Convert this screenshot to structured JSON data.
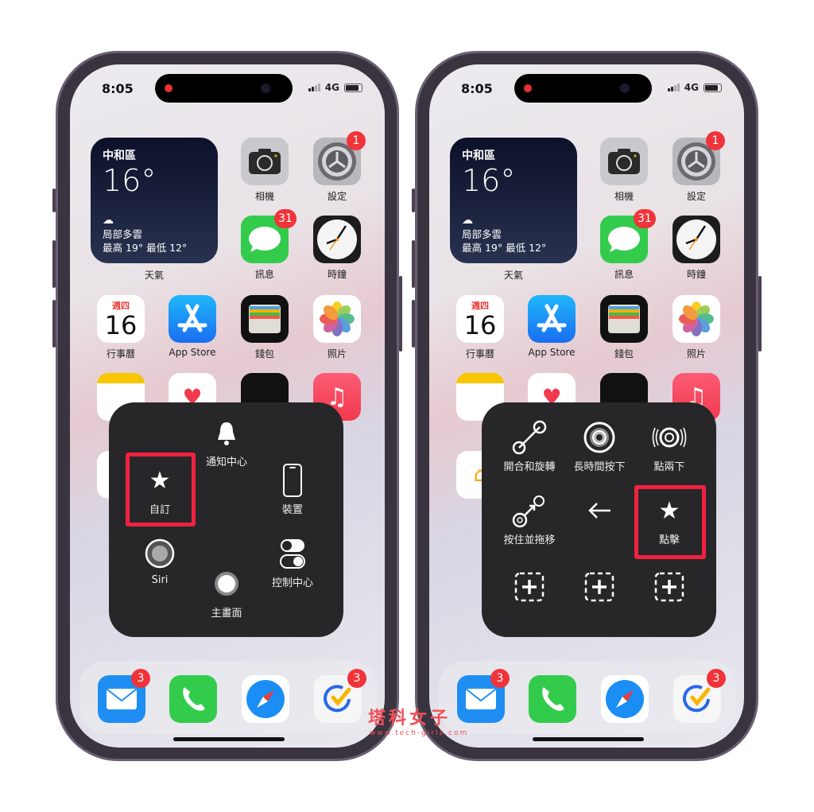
{
  "colors": {
    "badge": "#f0343a",
    "highlight": "#f0213f",
    "menu_bg": "#27272a",
    "watermark": "#f05058"
  },
  "status_bar": {
    "time": "8:05",
    "network": "4G"
  },
  "weather_widget": {
    "location": "中和區",
    "temperature": "16°",
    "condition": "局部多雲",
    "high_low": "最高 19° 最低 12°",
    "label": "天氣"
  },
  "apps": [
    {
      "label": "相機",
      "icon": "camera-icon"
    },
    {
      "label": "設定",
      "icon": "settings-icon",
      "badge": "1"
    },
    {
      "label": "訊息",
      "icon": "messages-icon",
      "badge": "31"
    },
    {
      "label": "時鐘",
      "icon": "clock-icon"
    },
    {
      "label": "行事曆",
      "icon": "calendar-icon",
      "weekday": "週四",
      "day": "16"
    },
    {
      "label": "App Store",
      "icon": "app-store-icon"
    },
    {
      "label": "錢包",
      "icon": "wallet-icon"
    },
    {
      "label": "照片",
      "icon": "photos-icon"
    }
  ],
  "dock": [
    {
      "icon": "mail-icon",
      "badge": "3"
    },
    {
      "icon": "phone-icon"
    },
    {
      "icon": "safari-icon"
    },
    {
      "icon": "tasks-icon",
      "badge": "3"
    }
  ],
  "left_menu": {
    "items": [
      {
        "label": "通知中心",
        "icon": "bell-icon"
      },
      {
        "label": "自訂",
        "icon": "star-icon",
        "highlighted": true
      },
      {
        "label": "裝置",
        "icon": "device-icon"
      },
      {
        "label": "Siri",
        "icon": "siri-icon"
      },
      {
        "label": "控制中心",
        "icon": "toggle-icon"
      },
      {
        "label": "主畫面",
        "icon": "home-button-icon"
      }
    ]
  },
  "right_menu": {
    "items": [
      {
        "label": "開合和旋轉",
        "icon": "pinch-rotate-icon"
      },
      {
        "label": "長時間按下",
        "icon": "long-press-icon"
      },
      {
        "label": "點兩下",
        "icon": "double-tap-icon"
      },
      {
        "label": "按住並拖移",
        "icon": "drag-icon"
      },
      {
        "label": "",
        "icon": "back-arrow-icon"
      },
      {
        "label": "點擊",
        "icon": "star-icon",
        "highlighted": true
      },
      {
        "label": "",
        "icon": "add-slot-icon"
      },
      {
        "label": "",
        "icon": "add-slot-icon"
      },
      {
        "label": "",
        "icon": "add-slot-icon"
      }
    ]
  },
  "watermark": {
    "name": "塔科女子",
    "url": "www.tech-girlz.com"
  }
}
